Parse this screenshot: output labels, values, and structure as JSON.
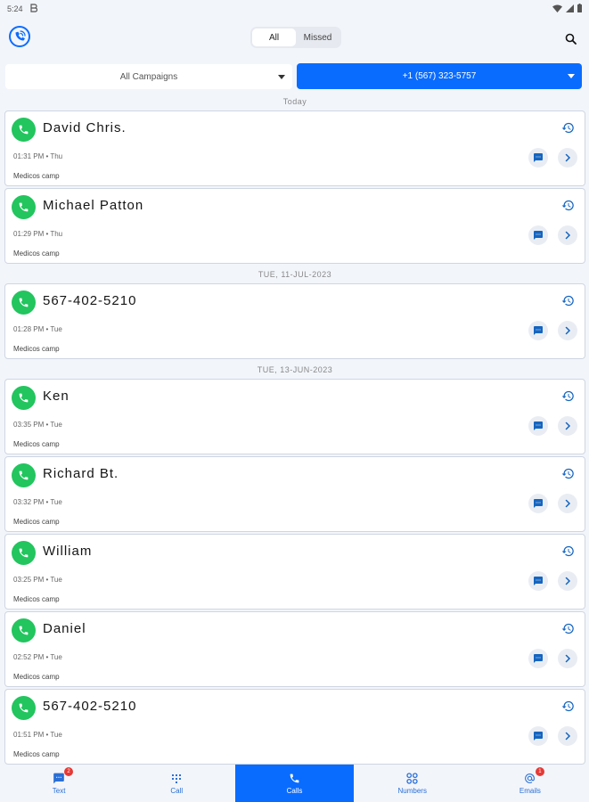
{
  "status_bar": {
    "time": "5:24",
    "notification_icon": "b-icon",
    "right_icons": [
      "wifi-icon",
      "signal-icon",
      "battery-icon"
    ]
  },
  "header": {
    "logo_icon": "phone-logo-icon",
    "filter_tabs": [
      {
        "label": "All",
        "active": true
      },
      {
        "label": "Missed",
        "active": false
      }
    ],
    "search_icon": "search-icon"
  },
  "filters": {
    "campaign": "All Campaigns",
    "number": "+1 (567) 323-5757"
  },
  "groups": [
    {
      "date": "Today",
      "calls": [
        {
          "name": "David Chris.",
          "time": "01:31 PM • Thu",
          "campaign": "Medicos camp"
        },
        {
          "name": "Michael Patton",
          "time": "01:29 PM • Thu",
          "campaign": "Medicos camp"
        }
      ]
    },
    {
      "date": "TUE, 11-JUL-2023",
      "calls": [
        {
          "name": "567-402-5210",
          "time": "01:28 PM • Tue",
          "campaign": "Medicos camp"
        }
      ]
    },
    {
      "date": "TUE, 13-JUN-2023",
      "calls": [
        {
          "name": "Ken",
          "time": "03:35 PM • Tue",
          "campaign": "Medicos camp"
        },
        {
          "name": "Richard Bt.",
          "time": "03:32 PM • Tue",
          "campaign": "Medicos camp"
        },
        {
          "name": "William",
          "time": "03:25 PM • Tue",
          "campaign": "Medicos camp"
        },
        {
          "name": "Daniel",
          "time": "02:52 PM • Tue",
          "campaign": "Medicos camp"
        },
        {
          "name": "567-402-5210",
          "time": "01:51 PM • Tue",
          "campaign": "Medicos camp"
        }
      ]
    }
  ],
  "bottom_nav": [
    {
      "label": "Text",
      "icon": "message-icon",
      "badge": "2",
      "active": false
    },
    {
      "label": "Call",
      "icon": "dialpad-icon",
      "badge": "",
      "active": false
    },
    {
      "label": "Calls",
      "icon": "phone-icon",
      "badge": "",
      "active": true
    },
    {
      "label": "Numbers",
      "icon": "grid-icon",
      "badge": "",
      "active": false
    },
    {
      "label": "Emails",
      "icon": "at-icon",
      "badge": "1",
      "active": false
    }
  ],
  "colors": {
    "accent": "#0a6cff",
    "call_green": "#22c55e",
    "badge_red": "#e53935"
  }
}
